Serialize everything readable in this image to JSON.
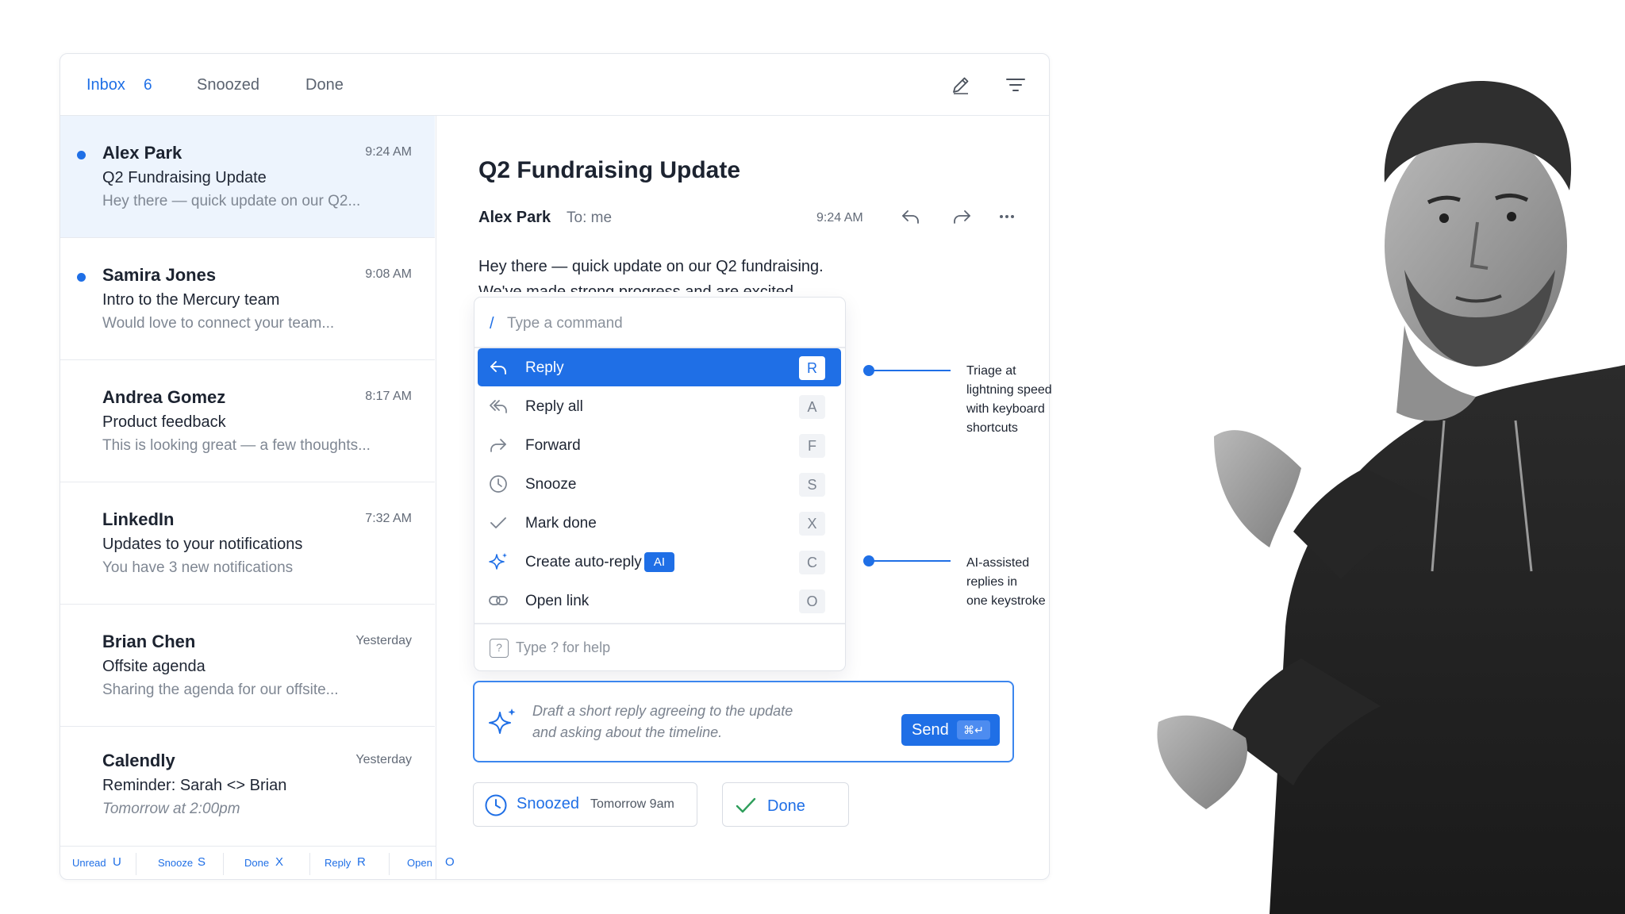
{
  "tabs": {
    "inbox": "Inbox",
    "inbox_count": "6",
    "snoozed": "Snoozed",
    "done": "Done"
  },
  "toolbar_icons": [
    "compose-icon",
    "filter-icon"
  ],
  "emails": [
    {
      "sender": "Alex Park",
      "time": "9:24 AM",
      "subject": "Q2 Fundraising Update",
      "preview": "Hey there — quick update on our Q2...",
      "unread": true,
      "selected": true
    },
    {
      "sender": "Samira Jones",
      "time": "9:08 AM",
      "subject": "Intro to the Mercury team",
      "preview": "Would love to connect your team...",
      "unread": true,
      "selected": false
    },
    {
      "sender": "Andrea Gomez",
      "time": "8:17 AM",
      "subject": "Product feedback",
      "preview": "This is looking great — a few thoughts...",
      "unread": false,
      "selected": false
    },
    {
      "sender": "LinkedIn",
      "time": "7:32 AM",
      "subject": "Updates to your notifications",
      "preview": "You have 3 new notifications",
      "unread": false,
      "selected": false
    },
    {
      "sender": "Brian Chen",
      "time": "Yesterday",
      "subject": "Offsite agenda",
      "preview": "Sharing the agenda for our offsite...",
      "unread": false,
      "selected": false
    },
    {
      "sender": "Calendly",
      "time": "Yesterday",
      "subject": "Reminder: Sarah <> Brian",
      "preview": "Tomorrow at 2:00pm",
      "unread": false,
      "selected": false
    }
  ],
  "footer_shortcuts": [
    {
      "label": "Unread",
      "key": "U"
    },
    {
      "label": "Snooze",
      "key": "S"
    },
    {
      "label": "Done",
      "key": "X"
    },
    {
      "label": "Reply",
      "key": "R"
    },
    {
      "label": "Open",
      "key": "O"
    }
  ],
  "message": {
    "title": "Q2 Fundraising Update",
    "from": "Alex Park",
    "to": "To: me",
    "time": "9:24 AM",
    "body_line1": "Hey there — quick update on our Q2 fundraising.",
    "body_line2": "We've made strong progress and are excited"
  },
  "message_actions": [
    "reply-icon",
    "forward-icon",
    "more-icon"
  ],
  "palette": {
    "prefix": "/",
    "placeholder": "Type a command",
    "commands": [
      {
        "label": "Reply",
        "key": "R",
        "icon": "reply-icon",
        "active": true
      },
      {
        "label": "Reply all",
        "key": "A",
        "icon": "reply-all-icon",
        "active": false
      },
      {
        "label": "Forward",
        "key": "F",
        "icon": "forward-icon",
        "active": false
      },
      {
        "label": "Snooze",
        "key": "S",
        "icon": "clock-icon",
        "active": false
      },
      {
        "label": "Mark done",
        "key": "X",
        "icon": "check-icon",
        "active": false
      },
      {
        "label": "Create auto-reply",
        "key": "C",
        "icon": "sparkle-icon",
        "active": false,
        "badge": "AI"
      },
      {
        "label": "Open link",
        "key": "O",
        "icon": "link-icon",
        "active": false
      }
    ],
    "help_icon": "?",
    "help_text": "Type ? for help"
  },
  "composer": {
    "draft_line1": "Draft a short reply agreeing to the update",
    "draft_line2": "and asking about the timeline.",
    "send_label": "Send",
    "send_shortcut": "⌘↵"
  },
  "status": {
    "snoozed_label": "Snoozed",
    "snoozed_time": "Tomorrow 9am",
    "done_label": "Done"
  },
  "callouts": [
    {
      "lines": [
        "Triage at",
        "lightning speed",
        "with keyboard",
        "shortcuts"
      ]
    },
    {
      "lines": [
        "AI-assisted",
        "replies in",
        "one keystroke"
      ]
    }
  ],
  "colors": {
    "accent": "#1f6fe6",
    "selected_row": "#edf4fd",
    "text": "#1c2330",
    "muted": "#7f8793"
  }
}
